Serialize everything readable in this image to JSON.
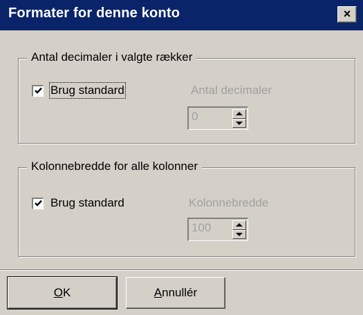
{
  "window": {
    "title": "Formater for denne konto",
    "close_glyph": "×"
  },
  "decimals_group": {
    "legend": "Antal decimaler i valgte rækker",
    "use_default_label": "Brug standard",
    "use_default_checked": true,
    "field_label": "Antal decimaler",
    "value": "0"
  },
  "width_group": {
    "legend": "Kolonnebredde for alle kolonner",
    "use_default_label": "Brug standard",
    "use_default_checked": true,
    "field_label": "Kolonnebredde",
    "value": "100"
  },
  "buttons": {
    "ok_mnemonic": "O",
    "ok_rest": "K",
    "cancel_mnemonic": "A",
    "cancel_rest": "nnullér"
  },
  "icons": {
    "close": "close-icon",
    "checkmark": "checkmark-icon",
    "spin_up": "chevron-up-icon",
    "spin_down": "chevron-down-icon"
  },
  "colors": {
    "titlebar": "#0a246a",
    "face": "#d4d0c8",
    "disabled_text": "#a0a0a0"
  }
}
